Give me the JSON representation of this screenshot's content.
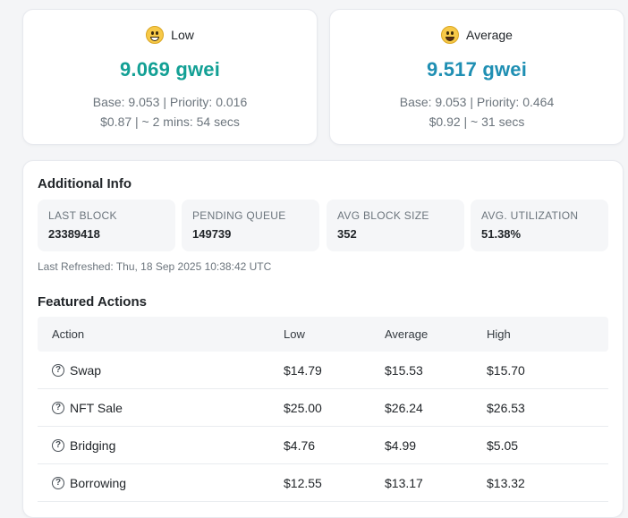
{
  "gas": {
    "low": {
      "label": "Low",
      "icon": "grinning-face-icon",
      "value": "9.069 gwei",
      "base_priority": "Base: 9.053 | Priority: 0.016",
      "cost_time": "$0.87 | ~ 2 mins: 54 secs",
      "color": "#13a095"
    },
    "average": {
      "label": "Average",
      "icon": "smiling-face-icon",
      "value": "9.517 gwei",
      "base_priority": "Base: 9.053 | Priority: 0.464",
      "cost_time": "$0.92 | ~ 31 secs",
      "color": "#1f8fb3"
    }
  },
  "additional_info": {
    "title": "Additional Info",
    "stats": [
      {
        "label": "LAST BLOCK",
        "value": "23389418"
      },
      {
        "label": "PENDING QUEUE",
        "value": "149739"
      },
      {
        "label": "AVG BLOCK SIZE",
        "value": "352"
      },
      {
        "label": "AVG. UTILIZATION",
        "value": "51.38%"
      }
    ],
    "refreshed": "Last Refreshed: Thu, 18 Sep 2025 10:38:42 UTC"
  },
  "featured": {
    "title": "Featured Actions",
    "headers": [
      "Action",
      "Low",
      "Average",
      "High"
    ],
    "rows": [
      {
        "action": "Swap",
        "low": "$14.79",
        "average": "$15.53",
        "high": "$15.70"
      },
      {
        "action": "NFT Sale",
        "low": "$25.00",
        "average": "$26.24",
        "high": "$26.53"
      },
      {
        "action": "Bridging",
        "low": "$4.76",
        "average": "$4.99",
        "high": "$5.05"
      },
      {
        "action": "Borrowing",
        "low": "$12.55",
        "average": "$13.17",
        "high": "$13.32"
      }
    ]
  }
}
